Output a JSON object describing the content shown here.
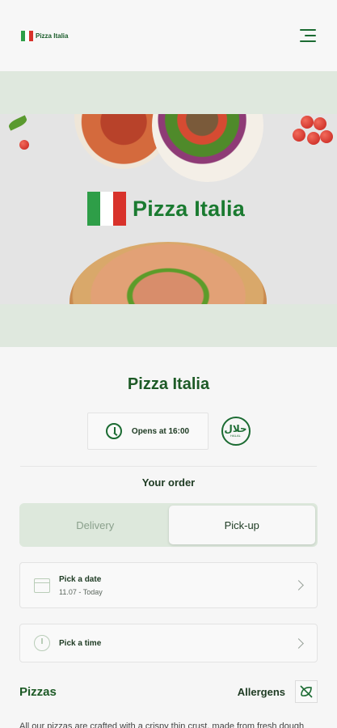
{
  "header": {
    "brand_name": "Pizza Italia",
    "menu_icon": "hamburger-menu-icon"
  },
  "hero": {
    "title": "Pizza Italia",
    "flag_colors": [
      "#2e9e48",
      "#ffffff",
      "#d8322b"
    ]
  },
  "restaurant": {
    "name": "Pizza Italia",
    "hours_text": "Opens at 16:00",
    "clock_icon": "clock-icon",
    "badge_icon": "halal-badge-icon",
    "badge_arabic": "حلال",
    "badge_text": "HALAL"
  },
  "order": {
    "title": "Your order",
    "options": [
      "Delivery",
      "Pick-up"
    ],
    "selected": "Pick-up",
    "date": {
      "label": "Pick a date",
      "value": "11.07 - Today",
      "icon": "calendar-icon"
    },
    "time": {
      "label": "Pick a time",
      "icon": "clock-icon"
    }
  },
  "menu": {
    "category": "Pizzas",
    "allergens_label": "Allergens",
    "allergens_icon": "allergen-filter-icon",
    "description": "All our pizzas are crafted with a crispy thin crust, made from fresh dough"
  },
  "colors": {
    "brand_green": "#1b6b32",
    "banner_tint": "#dfe8de",
    "background": "#f6f6f6"
  }
}
